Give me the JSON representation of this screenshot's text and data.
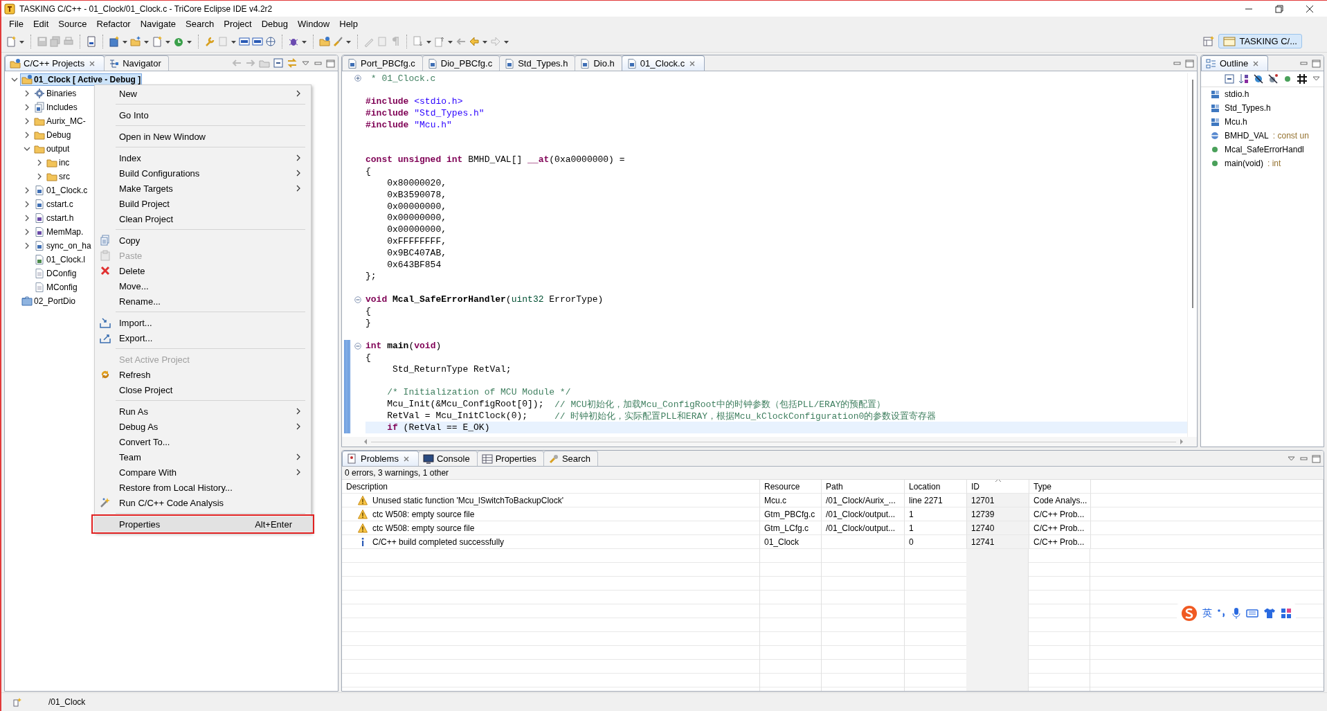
{
  "window": {
    "title": "TASKING C/C++ - 01_Clock/01_Clock.c - TriCore Eclipse IDE v4.2r2"
  },
  "menu_bar": [
    "File",
    "Edit",
    "Source",
    "Refactor",
    "Navigate",
    "Search",
    "Project",
    "Debug",
    "Window",
    "Help"
  ],
  "perspective": {
    "label": "TASKING C/...",
    "selected": true
  },
  "project_explorer": {
    "tabs": [
      {
        "label": "C/C++ Projects",
        "selected": true
      },
      {
        "label": "Navigator",
        "selected": false
      }
    ],
    "tree": [
      {
        "label": "01_Clock [ Active - Debug ]",
        "kind": "project",
        "expanded": true,
        "selected": true,
        "children": [
          {
            "label": "Binaries",
            "kind": "binaries",
            "expanded": false,
            "selected": false
          },
          {
            "label": "Includes",
            "kind": "includes",
            "expanded": false,
            "selected": false
          },
          {
            "label": "Aurix_MC-",
            "kind": "folder",
            "expanded": false,
            "selected": false
          },
          {
            "label": "Debug",
            "kind": "folder",
            "expanded": false,
            "selected": false
          },
          {
            "label": "output",
            "kind": "folder",
            "expanded": true,
            "selected": false,
            "children": [
              {
                "label": "inc",
                "kind": "folder",
                "expanded": false,
                "selected": false
              },
              {
                "label": "src",
                "kind": "folder",
                "expanded": false,
                "selected": false
              }
            ]
          },
          {
            "label": "01_Clock.c",
            "kind": "c-file",
            "expanded": false,
            "selected": false
          },
          {
            "label": "cstart.c",
            "kind": "c-file",
            "expanded": false,
            "selected": false
          },
          {
            "label": "cstart.h",
            "kind": "h-file",
            "expanded": false,
            "selected": false
          },
          {
            "label": "MemMap.",
            "kind": "h-file",
            "expanded": false,
            "selected": false
          },
          {
            "label": "sync_on_ha",
            "kind": "c-file",
            "expanded": false,
            "selected": false
          },
          {
            "label": "01_Clock.l",
            "kind": "linker-file",
            "selected": false
          },
          {
            "label": "DConfig",
            "kind": "file",
            "selected": false
          },
          {
            "label": "MConfig",
            "kind": "file",
            "selected": false
          }
        ]
      },
      {
        "label": "02_PortDio",
        "kind": "closed-project",
        "selected": false
      }
    ]
  },
  "context_menu": [
    {
      "kind": "item",
      "label": "New",
      "submenu": true,
      "disabled": false,
      "selected": false,
      "outlined": false
    },
    {
      "kind": "separator"
    },
    {
      "kind": "item",
      "label": "Go Into",
      "submenu": false,
      "disabled": false,
      "selected": false,
      "outlined": false
    },
    {
      "kind": "separator"
    },
    {
      "kind": "item",
      "label": "Open in New Window",
      "submenu": false,
      "disabled": false,
      "selected": false,
      "outlined": false
    },
    {
      "kind": "separator"
    },
    {
      "kind": "item",
      "label": "Index",
      "submenu": true,
      "disabled": false,
      "selected": false,
      "outlined": false
    },
    {
      "kind": "item",
      "label": "Build Configurations",
      "submenu": true,
      "disabled": false,
      "selected": false,
      "outlined": false
    },
    {
      "kind": "item",
      "label": "Make Targets",
      "submenu": true,
      "disabled": false,
      "selected": false,
      "outlined": false
    },
    {
      "kind": "item",
      "label": "Build Project",
      "submenu": false,
      "disabled": false,
      "selected": false,
      "outlined": false
    },
    {
      "kind": "item",
      "label": "Clean Project",
      "submenu": false,
      "disabled": false,
      "selected": false,
      "outlined": false
    },
    {
      "kind": "separator"
    },
    {
      "kind": "item",
      "label": "Copy",
      "submenu": false,
      "disabled": false,
      "selected": false,
      "outlined": false
    },
    {
      "kind": "item",
      "label": "Paste",
      "submenu": false,
      "disabled": true,
      "selected": false,
      "outlined": false
    },
    {
      "kind": "item",
      "label": "Delete",
      "submenu": false,
      "disabled": false,
      "selected": false,
      "outlined": false
    },
    {
      "kind": "item",
      "label": "Move...",
      "submenu": false,
      "disabled": false,
      "selected": false,
      "outlined": false
    },
    {
      "kind": "item",
      "label": "Rename...",
      "submenu": false,
      "disabled": false,
      "selected": false,
      "outlined": false
    },
    {
      "kind": "separator"
    },
    {
      "kind": "item",
      "label": "Import...",
      "submenu": false,
      "disabled": false,
      "selected": false,
      "outlined": false
    },
    {
      "kind": "item",
      "label": "Export...",
      "submenu": false,
      "disabled": false,
      "selected": false,
      "outlined": false
    },
    {
      "kind": "separator"
    },
    {
      "kind": "item",
      "label": "Set Active Project",
      "submenu": false,
      "disabled": true,
      "selected": false,
      "outlined": false
    },
    {
      "kind": "item",
      "label": "Refresh",
      "submenu": false,
      "disabled": false,
      "selected": false,
      "outlined": false
    },
    {
      "kind": "item",
      "label": "Close Project",
      "submenu": false,
      "disabled": false,
      "selected": false,
      "outlined": false
    },
    {
      "kind": "separator"
    },
    {
      "kind": "item",
      "label": "Run As",
      "submenu": true,
      "disabled": false,
      "selected": false,
      "outlined": false
    },
    {
      "kind": "item",
      "label": "Debug As",
      "submenu": true,
      "disabled": false,
      "selected": false,
      "outlined": false
    },
    {
      "kind": "item",
      "label": "Convert To...",
      "submenu": false,
      "disabled": false,
      "selected": false,
      "outlined": false
    },
    {
      "kind": "item",
      "label": "Team",
      "submenu": true,
      "disabled": false,
      "selected": false,
      "outlined": false
    },
    {
      "kind": "item",
      "label": "Compare With",
      "submenu": true,
      "disabled": false,
      "selected": false,
      "outlined": false
    },
    {
      "kind": "item",
      "label": "Restore from Local History...",
      "submenu": false,
      "disabled": false,
      "selected": false,
      "outlined": false
    },
    {
      "kind": "item",
      "label": "Run C/C++ Code Analysis",
      "submenu": false,
      "disabled": false,
      "selected": false,
      "outlined": false
    },
    {
      "kind": "separator"
    },
    {
      "kind": "item",
      "label": "Properties",
      "shortcut": "Alt+Enter",
      "submenu": false,
      "disabled": false,
      "selected": true,
      "outlined": true
    }
  ],
  "editor": {
    "tabs": [
      {
        "label": "Port_PBCfg.c",
        "selected": false
      },
      {
        "label": "Dio_PBCfg.c",
        "selected": false
      },
      {
        "label": "Std_Types.h",
        "selected": false
      },
      {
        "label": "Dio.h",
        "selected": false
      },
      {
        "label": "01_Clock.c",
        "selected": true
      }
    ],
    "lines": [
      {
        "kind": "code",
        "expanded": false,
        "changed": false,
        "current": false,
        "tokens": [
          {
            "kind": "comment",
            "text": " * 01_Clock.c"
          }
        ]
      },
      {
        "kind": "blank",
        "changed": false,
        "current": false
      },
      {
        "kind": "code",
        "changed": false,
        "current": false,
        "tokens": [
          {
            "kind": "keyword",
            "text": "#include"
          },
          {
            "kind": "string",
            "text": " <stdio.h>"
          }
        ]
      },
      {
        "kind": "code",
        "changed": false,
        "current": false,
        "tokens": [
          {
            "kind": "keyword",
            "text": "#include"
          },
          {
            "kind": "string",
            "text": " \"Std_Types.h\""
          }
        ]
      },
      {
        "kind": "code",
        "changed": false,
        "current": false,
        "tokens": [
          {
            "kind": "keyword",
            "text": "#include"
          },
          {
            "kind": "string",
            "text": " \"Mcu.h\""
          }
        ]
      },
      {
        "kind": "blank",
        "changed": false,
        "current": false
      },
      {
        "kind": "blank",
        "changed": false,
        "current": false
      },
      {
        "kind": "code",
        "changed": false,
        "current": false,
        "tokens": [
          {
            "kind": "keyword",
            "text": "const unsigned int"
          },
          {
            "kind": "plain",
            "text": " BMHD_VAL[] "
          },
          {
            "kind": "keyword",
            "text": "__at"
          },
          {
            "kind": "plain",
            "text": "(0xa0000000) ="
          }
        ]
      },
      {
        "kind": "code",
        "changed": false,
        "current": false,
        "tokens": [
          {
            "kind": "plain",
            "text": "{"
          }
        ]
      },
      {
        "kind": "code",
        "changed": false,
        "current": false,
        "tokens": [
          {
            "kind": "plain",
            "text": "    0x80000020,"
          }
        ]
      },
      {
        "kind": "code",
        "changed": false,
        "current": false,
        "tokens": [
          {
            "kind": "plain",
            "text": "    0xB3590078,"
          }
        ]
      },
      {
        "kind": "code",
        "changed": false,
        "current": false,
        "tokens": [
          {
            "kind": "plain",
            "text": "    0x00000000,"
          }
        ]
      },
      {
        "kind": "code",
        "changed": false,
        "current": false,
        "tokens": [
          {
            "kind": "plain",
            "text": "    0x00000000,"
          }
        ]
      },
      {
        "kind": "code",
        "changed": false,
        "current": false,
        "tokens": [
          {
            "kind": "plain",
            "text": "    0x00000000,"
          }
        ]
      },
      {
        "kind": "code",
        "changed": false,
        "current": false,
        "tokens": [
          {
            "kind": "plain",
            "text": "    0xFFFFFFFF,"
          }
        ]
      },
      {
        "kind": "code",
        "changed": false,
        "current": false,
        "tokens": [
          {
            "kind": "plain",
            "text": "    0x9BC407AB,"
          }
        ]
      },
      {
        "kind": "code",
        "changed": false,
        "current": false,
        "tokens": [
          {
            "kind": "plain",
            "text": "    0x643BF854"
          }
        ]
      },
      {
        "kind": "code",
        "changed": false,
        "current": false,
        "tokens": [
          {
            "kind": "plain",
            "text": "};"
          }
        ]
      },
      {
        "kind": "blank",
        "changed": false,
        "current": false
      },
      {
        "kind": "code",
        "expanded": true,
        "changed": false,
        "current": false,
        "tokens": [
          {
            "kind": "keyword",
            "text": "void"
          },
          {
            "kind": "bold",
            "text": " Mcal_SafeErrorHandler"
          },
          {
            "kind": "plain",
            "text": "("
          },
          {
            "kind": "type",
            "text": "uint32"
          },
          {
            "kind": "plain",
            "text": " ErrorType)"
          }
        ]
      },
      {
        "kind": "code",
        "changed": false,
        "current": false,
        "tokens": [
          {
            "kind": "plain",
            "text": "{"
          }
        ]
      },
      {
        "kind": "code",
        "changed": false,
        "current": false,
        "tokens": [
          {
            "kind": "plain",
            "text": "}"
          }
        ]
      },
      {
        "kind": "blank",
        "changed": false,
        "current": false
      },
      {
        "kind": "code",
        "expanded": true,
        "changed": true,
        "current": false,
        "tokens": [
          {
            "kind": "keyword",
            "text": "int"
          },
          {
            "kind": "bold",
            "text": " main"
          },
          {
            "kind": "plain",
            "text": "("
          },
          {
            "kind": "keyword",
            "text": "void"
          },
          {
            "kind": "plain",
            "text": ")"
          }
        ]
      },
      {
        "kind": "code",
        "changed": true,
        "current": false,
        "tokens": [
          {
            "kind": "plain",
            "text": "{"
          }
        ]
      },
      {
        "kind": "code",
        "changed": true,
        "current": false,
        "tokens": [
          {
            "kind": "plain",
            "text": "     Std_ReturnType RetVal;"
          }
        ]
      },
      {
        "kind": "blank",
        "changed": true,
        "current": false
      },
      {
        "kind": "code",
        "changed": true,
        "current": false,
        "tokens": [
          {
            "kind": "comment",
            "text": "    /* Initialization of MCU Module */"
          }
        ]
      },
      {
        "kind": "code",
        "changed": true,
        "current": false,
        "tokens": [
          {
            "kind": "plain",
            "text": "    Mcu_Init(&Mcu_ConfigRoot[0]);  "
          },
          {
            "kind": "comment",
            "text": "// MCU初始化，加载Mcu_ConfigRoot中的时钟参数（包括PLL/ERAY的预配置）"
          }
        ]
      },
      {
        "kind": "code",
        "changed": true,
        "current": false,
        "tokens": [
          {
            "kind": "plain",
            "text": "    RetVal = Mcu_InitClock(0);     "
          },
          {
            "kind": "comment",
            "text": "// 时钟初始化，实际配置PLL和ERAY，根据Mcu_kClockConfiguration0的参数设置寄存器"
          }
        ]
      },
      {
        "kind": "code",
        "changed": true,
        "current": true,
        "tokens": [
          {
            "kind": "keyword",
            "text": "    if"
          },
          {
            "kind": "plain",
            "text": " (RetVal == E_OK)"
          }
        ]
      }
    ]
  },
  "outline": {
    "title": "Outline",
    "items": [
      {
        "label": "stdio.h",
        "kind": "include"
      },
      {
        "label": "Std_Types.h",
        "kind": "include"
      },
      {
        "label": "Mcu.h",
        "kind": "include"
      },
      {
        "label": "BMHD_VAL",
        "type": " : const un",
        "kind": "variable"
      },
      {
        "label": "Mcal_SafeErrorHandl",
        "kind": "function"
      },
      {
        "label": "main(void)",
        "type": " : int",
        "kind": "function"
      }
    ]
  },
  "problems": {
    "tabs": [
      {
        "label": "Problems",
        "selected": true
      },
      {
        "label": "Console",
        "selected": false
      },
      {
        "label": "Properties",
        "selected": false
      },
      {
        "label": "Search",
        "selected": false
      }
    ],
    "summary": "0 errors, 3 warnings, 1 other",
    "columns": [
      {
        "label": "Description",
        "sorted": false
      },
      {
        "label": "Resource",
        "sorted": false
      },
      {
        "label": "Path",
        "sorted": false
      },
      {
        "label": "Location",
        "sorted": false
      },
      {
        "label": "ID",
        "sorted": true
      },
      {
        "label": "Type",
        "sorted": false
      }
    ],
    "rows": [
      {
        "kind": "warning",
        "description": "Unused static function 'Mcu_lSwitchToBackupClock'",
        "resource": "Mcu.c",
        "path": "/01_Clock/Aurix_...",
        "location": "line 2271",
        "id": "12701",
        "type": "Code Analys..."
      },
      {
        "kind": "warning",
        "description": "ctc W508: empty source file",
        "resource": "Gtm_PBCfg.c",
        "path": "/01_Clock/output...",
        "location": "1",
        "id": "12739",
        "type": "C/C++ Prob..."
      },
      {
        "kind": "warning",
        "description": "ctc W508: empty source file",
        "resource": "Gtm_LCfg.c",
        "path": "/01_Clock/output...",
        "location": "1",
        "id": "12740",
        "type": "C/C++ Prob..."
      },
      {
        "kind": "info",
        "description": "C/C++ build completed successfully",
        "resource": "01_Clock",
        "location": "0",
        "id": "12741",
        "type": "C/C++ Prob..."
      }
    ]
  },
  "ime_bar": {
    "mode": "英"
  },
  "status_bar": {
    "text": "/01_Clock"
  }
}
